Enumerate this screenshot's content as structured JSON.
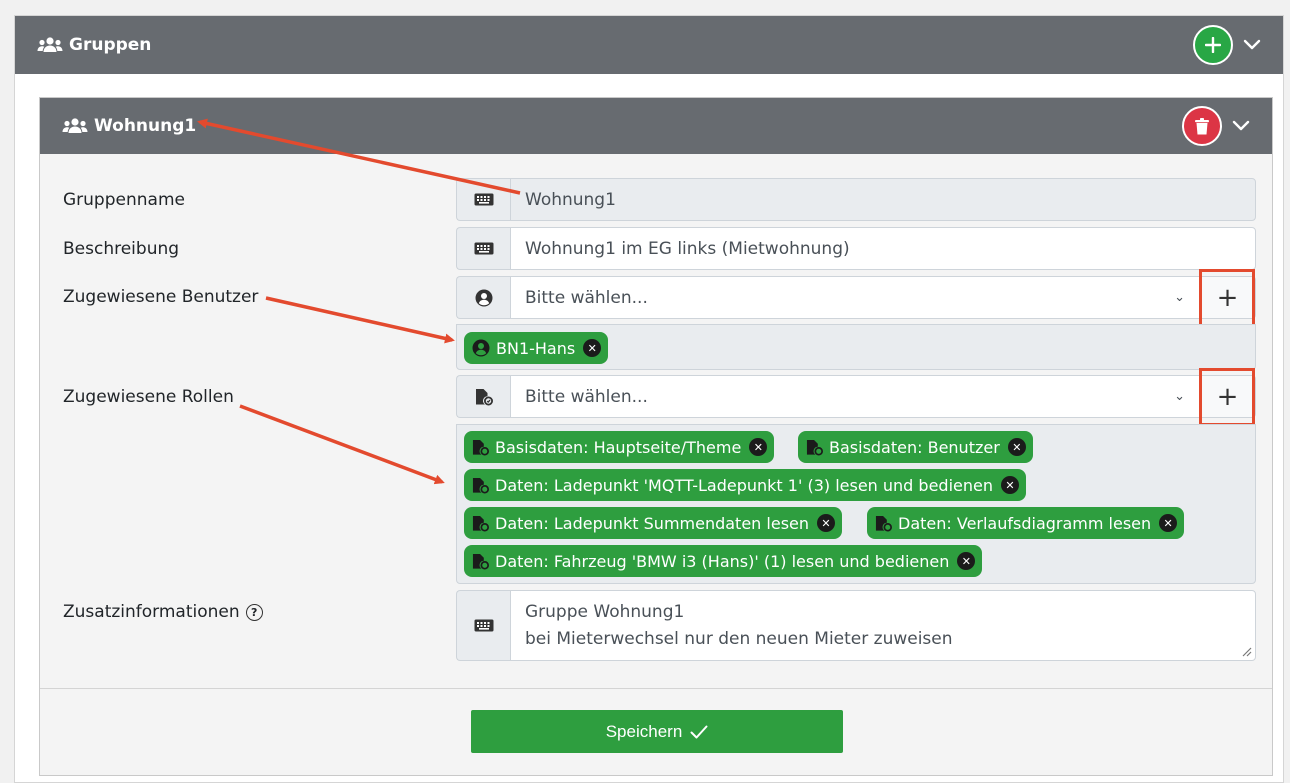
{
  "groups_panel": {
    "title": "Gruppen"
  },
  "group": {
    "title": "Wohnung1"
  },
  "form": {
    "groupname": {
      "label": "Gruppenname",
      "value": "Wohnung1"
    },
    "description": {
      "label": "Beschreibung",
      "value": "Wohnung1 im EG links (Mietwohnung)"
    },
    "users": {
      "label": "Zugewiesene Benutzer",
      "placeholder": "Bitte wählen...",
      "tags": [
        "BN1-Hans"
      ]
    },
    "roles": {
      "label": "Zugewiesene Rollen",
      "placeholder": "Bitte wählen...",
      "tags": [
        "Basisdaten: Hauptseite/Theme",
        "Basisdaten: Benutzer",
        "Daten: Ladepunkt 'MQTT-Ladepunkt 1' (3) lesen und bedienen",
        "Daten: Ladepunkt Summendaten lesen",
        "Daten: Verlaufsdiagramm lesen",
        "Daten: Fahrzeug 'BMW i3 (Hans)' (1) lesen und bedienen"
      ]
    },
    "extra": {
      "label": "Zusatzinformationen",
      "lines": [
        "Gruppe Wohnung1",
        "bei Mieterwechsel nur den neuen Mieter zuweisen"
      ]
    },
    "save_label": "Speichern"
  },
  "icons": {
    "group": "users-icon",
    "add": "plus-circle-icon",
    "delete": "trash-icon",
    "collapse": "chevron-down-icon",
    "keyboard": "keyboard-icon",
    "user": "user-circle-icon",
    "role": "user-tag-icon",
    "remove": "times-circle-icon",
    "help": "question-circle-icon",
    "check": "check-icon"
  },
  "colors": {
    "header": "#676b70",
    "success": "#2e9e3f",
    "danger": "#dc3545",
    "annotation": "#e34a2e"
  }
}
